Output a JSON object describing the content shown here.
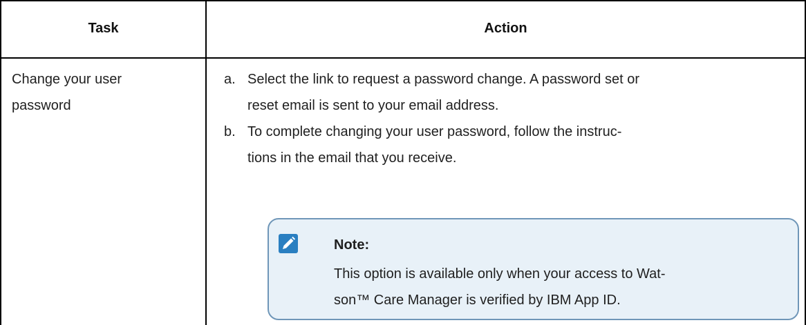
{
  "table": {
    "headers": {
      "task": "Task",
      "action": "Action"
    },
    "row": {
      "task_line1": "Change your user",
      "task_line2": "password",
      "steps": [
        {
          "marker": "a.",
          "line1": "Select the link to request a password change. A password set or",
          "line2": "reset email is sent to your email address."
        },
        {
          "marker": "b.",
          "line1": "To complete changing your user password, follow the instruc-",
          "line2": "tions in the email that you receive."
        }
      ],
      "note": {
        "icon": "pencil-note-icon",
        "title": "Note:",
        "line1": "This option is available only when your access to Wat-",
        "line2": "son™ Care Manager is verified by IBM App ID."
      }
    }
  },
  "colors": {
    "note_background": "#e8f1f8",
    "note_border": "#6f96b8",
    "note_icon": "#2a7fc1"
  }
}
